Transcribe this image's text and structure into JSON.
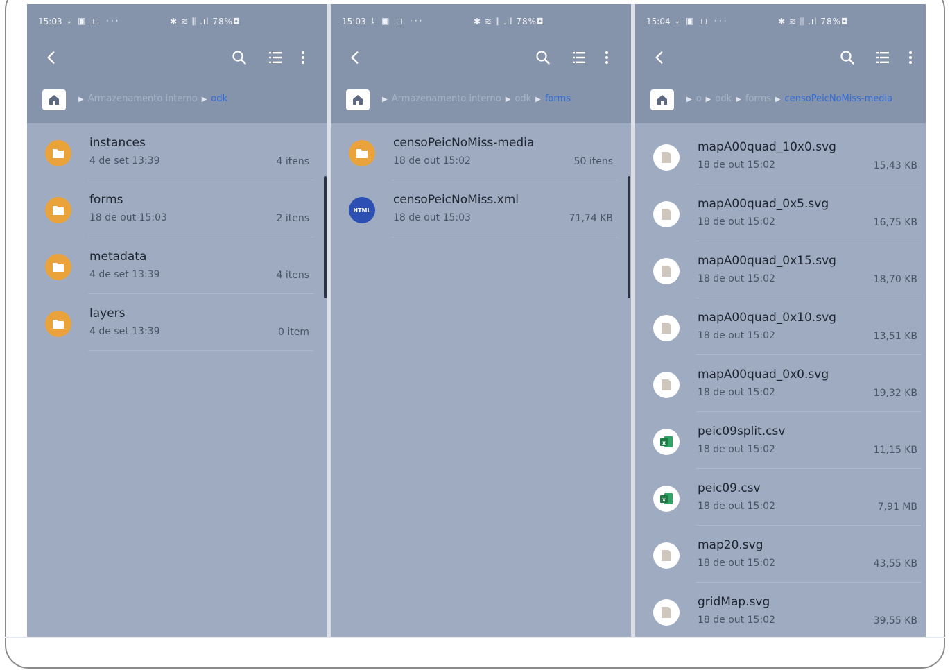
{
  "panels": [
    {
      "status": {
        "time": "15:03",
        "left_icons": "⤓ ▣ ◻ ···",
        "right_icons": "✱ ≋ ⫼ .ıl 78%◘"
      },
      "breadcrumb": {
        "items": [
          "Armazenamento interno"
        ],
        "active": "odk"
      },
      "items": [
        {
          "name": "instances",
          "date": "4 de set 13:39",
          "count": "4 itens",
          "type": "folder"
        },
        {
          "name": "forms",
          "date": "18 de out 15:03",
          "count": "2 itens",
          "type": "folder"
        },
        {
          "name": "metadata",
          "date": "4 de set 13:39",
          "count": "4 itens",
          "type": "folder"
        },
        {
          "name": "layers",
          "date": "4 de set 13:39",
          "count": "0 item",
          "type": "folder"
        }
      ]
    },
    {
      "status": {
        "time": "15:03",
        "left_icons": "⤓ ▣ ◻ ···",
        "right_icons": "✱ ≋ ⫼ .ıl 78%◘"
      },
      "breadcrumb": {
        "items": [
          "Armazenamento interno",
          "odk"
        ],
        "active": "forms"
      },
      "items": [
        {
          "name": "censoPeicNoMiss-media",
          "date": "18 de out 15:02",
          "count": "50 itens",
          "type": "folder"
        },
        {
          "name": "censoPeicNoMiss.xml",
          "date": "18 de out 15:03",
          "count": "71,74 KB",
          "type": "html",
          "badge": "HTML"
        }
      ]
    },
    {
      "status": {
        "time": "15:04",
        "left_icons": "⤓ ▣ ◻ ···",
        "right_icons": "✱ ≋ ⫼ .ıl 78%◘"
      },
      "breadcrumb": {
        "items": [
          "o",
          "odk",
          "forms"
        ],
        "active": "censoPeicNoMiss-media"
      },
      "items": [
        {
          "name": "mapA00quad_10x0.svg",
          "date": "18 de out 15:02",
          "count": "15,43 KB",
          "type": "file"
        },
        {
          "name": "mapA00quad_0x5.svg",
          "date": "18 de out 15:02",
          "count": "16,75 KB",
          "type": "file"
        },
        {
          "name": "mapA00quad_0x15.svg",
          "date": "18 de out 15:02",
          "count": "18,70 KB",
          "type": "file"
        },
        {
          "name": "mapA00quad_0x10.svg",
          "date": "18 de out 15:02",
          "count": "13,51 KB",
          "type": "file"
        },
        {
          "name": "mapA00quad_0x0.svg",
          "date": "18 de out 15:02",
          "count": "19,32 KB",
          "type": "file"
        },
        {
          "name": "peic09split.csv",
          "date": "18 de out 15:02",
          "count": "11,15 KB",
          "type": "csv"
        },
        {
          "name": "peic09.csv",
          "date": "18 de out 15:02",
          "count": "7,91 MB",
          "type": "csv"
        },
        {
          "name": "map20.svg",
          "date": "18 de out 15:02",
          "count": "43,55 KB",
          "type": "file"
        },
        {
          "name": "gridMap.svg",
          "date": "18 de out 15:02",
          "count": "39,55 KB",
          "type": "file"
        }
      ]
    }
  ],
  "colors": {
    "panel_bg": "#9eabc1",
    "header_bg": "#8694ab",
    "folder": "#eaa33a",
    "html_badge": "#2b4fb3",
    "csv": "#1f8a4a",
    "active_crumb": "#2f6bd8"
  },
  "icons": {
    "back": "back-arrow-icon",
    "search": "search-icon",
    "list_view": "list-view-icon",
    "more": "more-vert-icon",
    "home": "home-icon",
    "folder": "folder-icon",
    "html": "html-file-icon",
    "file": "generic-file-icon",
    "csv": "excel-file-icon"
  }
}
